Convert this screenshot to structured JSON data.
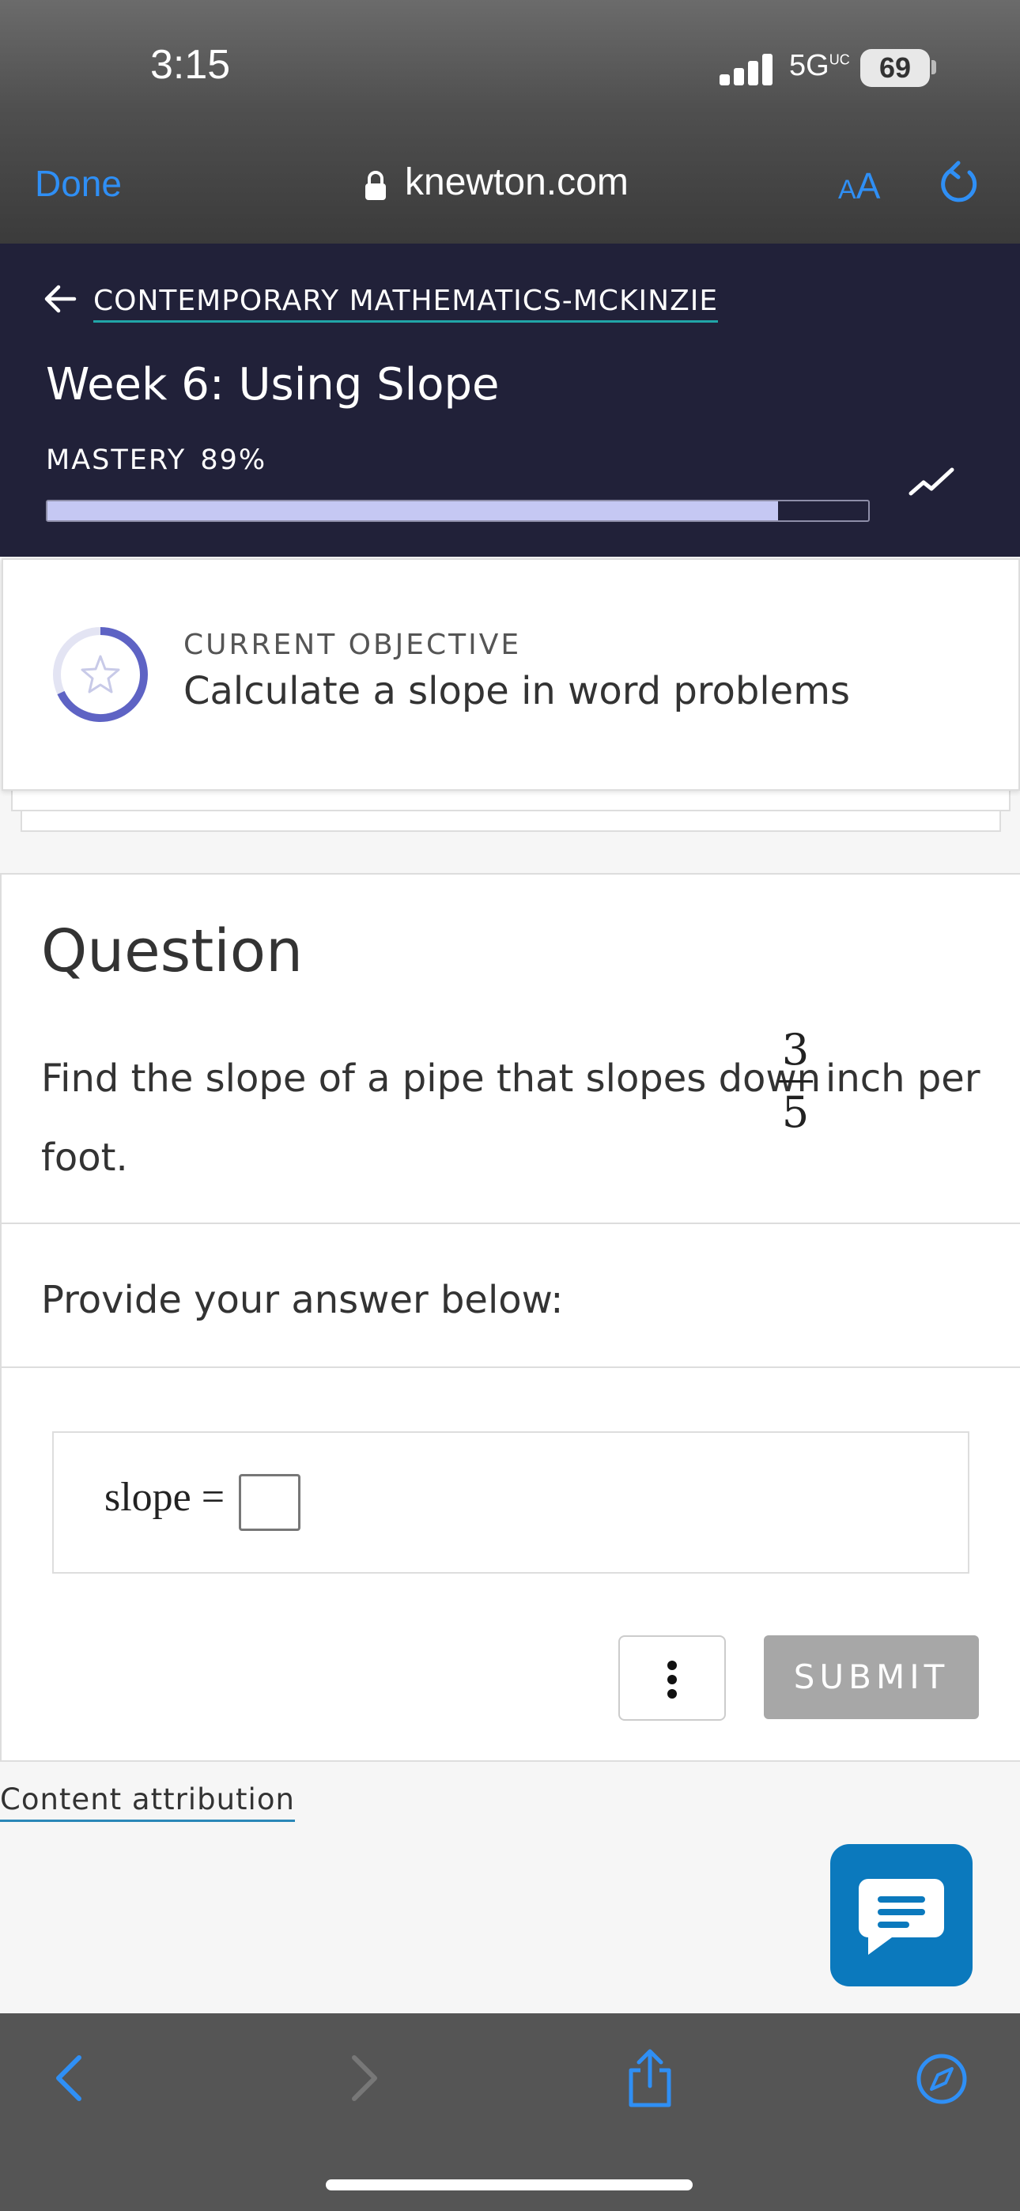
{
  "status_bar": {
    "time": "3:15",
    "network": "5G",
    "network_suffix": "UC",
    "battery": "69"
  },
  "browser": {
    "done_label": "Done",
    "url": "knewton.com",
    "text_size_small": "A",
    "text_size_large": "A"
  },
  "header": {
    "course_link": "CONTEMPORARY MATHEMATICS-MCKINZIE",
    "title": "Week 6: Using Slope",
    "mastery_label": "MASTERY",
    "mastery_value": "89%",
    "mastery_fraction": 0.89
  },
  "objective": {
    "label": "CURRENT OBJECTIVE",
    "text": "Calculate a slope in word problems"
  },
  "question": {
    "heading": "Question",
    "text_before": "Find the slope of a pipe that slopes down",
    "fraction_numerator": "3",
    "fraction_denominator": "5",
    "text_after": "inch per",
    "text_wrap": "foot.",
    "prompt": "Provide your answer below:",
    "answer_label": "slope =",
    "submit_label": "SUBMIT"
  },
  "footer": {
    "attribution_label": "Content attribution"
  },
  "colors": {
    "header_bg": "#212139",
    "accent_blue": "#2f8ff5",
    "chat_blue": "#0b79bd",
    "mastery_fill": "#c5c8f3"
  },
  "icons": [
    "lock-icon",
    "reload-icon",
    "back-arrow-icon",
    "trend-icon",
    "star-icon",
    "more-icon",
    "chat-icon",
    "back-icon",
    "forward-icon",
    "share-icon",
    "compass-icon"
  ]
}
